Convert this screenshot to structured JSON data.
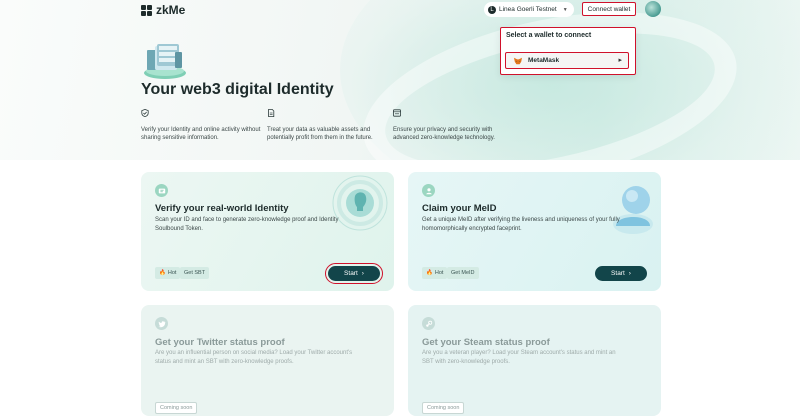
{
  "app": {
    "name": "zkMe"
  },
  "header": {
    "network_label": "Linea Goerli Testnet",
    "connect_label": "Connect wallet"
  },
  "wallet_popup": {
    "title": "Select a wallet to connect",
    "options": [
      {
        "label": "MetaMask",
        "icon": "metamask-fox-icon"
      }
    ]
  },
  "hero": {
    "title": "Your web3 digital Identity",
    "features": [
      {
        "icon": "shield-check-icon",
        "text": "Verify your Identity and online activity without sharing sensitive information."
      },
      {
        "icon": "document-icon",
        "text": "Treat your data as valuable assets and potentially profit from them in the future."
      },
      {
        "icon": "browser-window-icon",
        "text": "Ensure your privacy and security with advanced zero-knowledge technology."
      }
    ]
  },
  "cards": [
    {
      "title": "Verify your real-world Identity",
      "description": "Scan your ID and face to generate zero-knowledge proof and Identity Soulbound Token.",
      "tags": [
        "Hot",
        "Get SBT"
      ],
      "button": "Start",
      "icon": "id-card-icon"
    },
    {
      "title": "Claim your MeID",
      "description": "Get a unique MeID after verifying the liveness and uniqueness of your fully homomorphically encrypted faceprint.",
      "tags": [
        "Hot",
        "Get MeID"
      ],
      "button": "Start",
      "icon": "user-icon"
    },
    {
      "title": "Get your Twitter status proof",
      "description": "Are you an influential person on social media? Load your Twitter account's status and mint an SBT with zero-knowledge proofs.",
      "status": "Coming soon",
      "icon": "twitter-icon"
    },
    {
      "title": "Get your Steam status proof",
      "description": "Are you a veteran player? Load your Steam account's status and mint an SBT with zero-knowledge proofs.",
      "status": "Coming soon",
      "icon": "steam-icon"
    }
  ],
  "colors": {
    "accent": "#12454a",
    "highlight": "#d0112b",
    "tag_bg": "#d4ebe4",
    "hero_tint": "#d9efe9"
  }
}
